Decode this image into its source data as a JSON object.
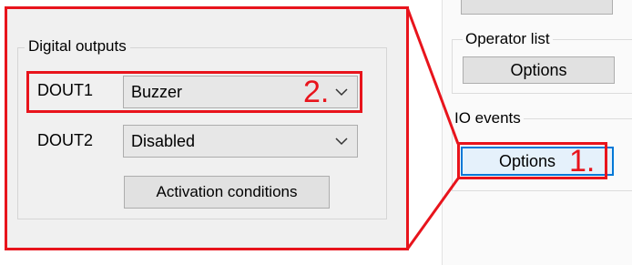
{
  "digital_outputs": {
    "group_title": "Digital outputs",
    "dout1": {
      "label": "DOUT1",
      "value": "Buzzer"
    },
    "dout2": {
      "label": "DOUT2",
      "value": "Disabled"
    },
    "activation_button": "Activation conditions"
  },
  "right_panel": {
    "operator_list": {
      "title": "Operator list",
      "button": "Options"
    },
    "io_events": {
      "title": "IO events",
      "button": "Options"
    }
  },
  "annotations": {
    "step1": "1.",
    "step2": "2."
  },
  "colors": {
    "highlight": "#e8141c",
    "focus_blue": "#0078d7"
  }
}
